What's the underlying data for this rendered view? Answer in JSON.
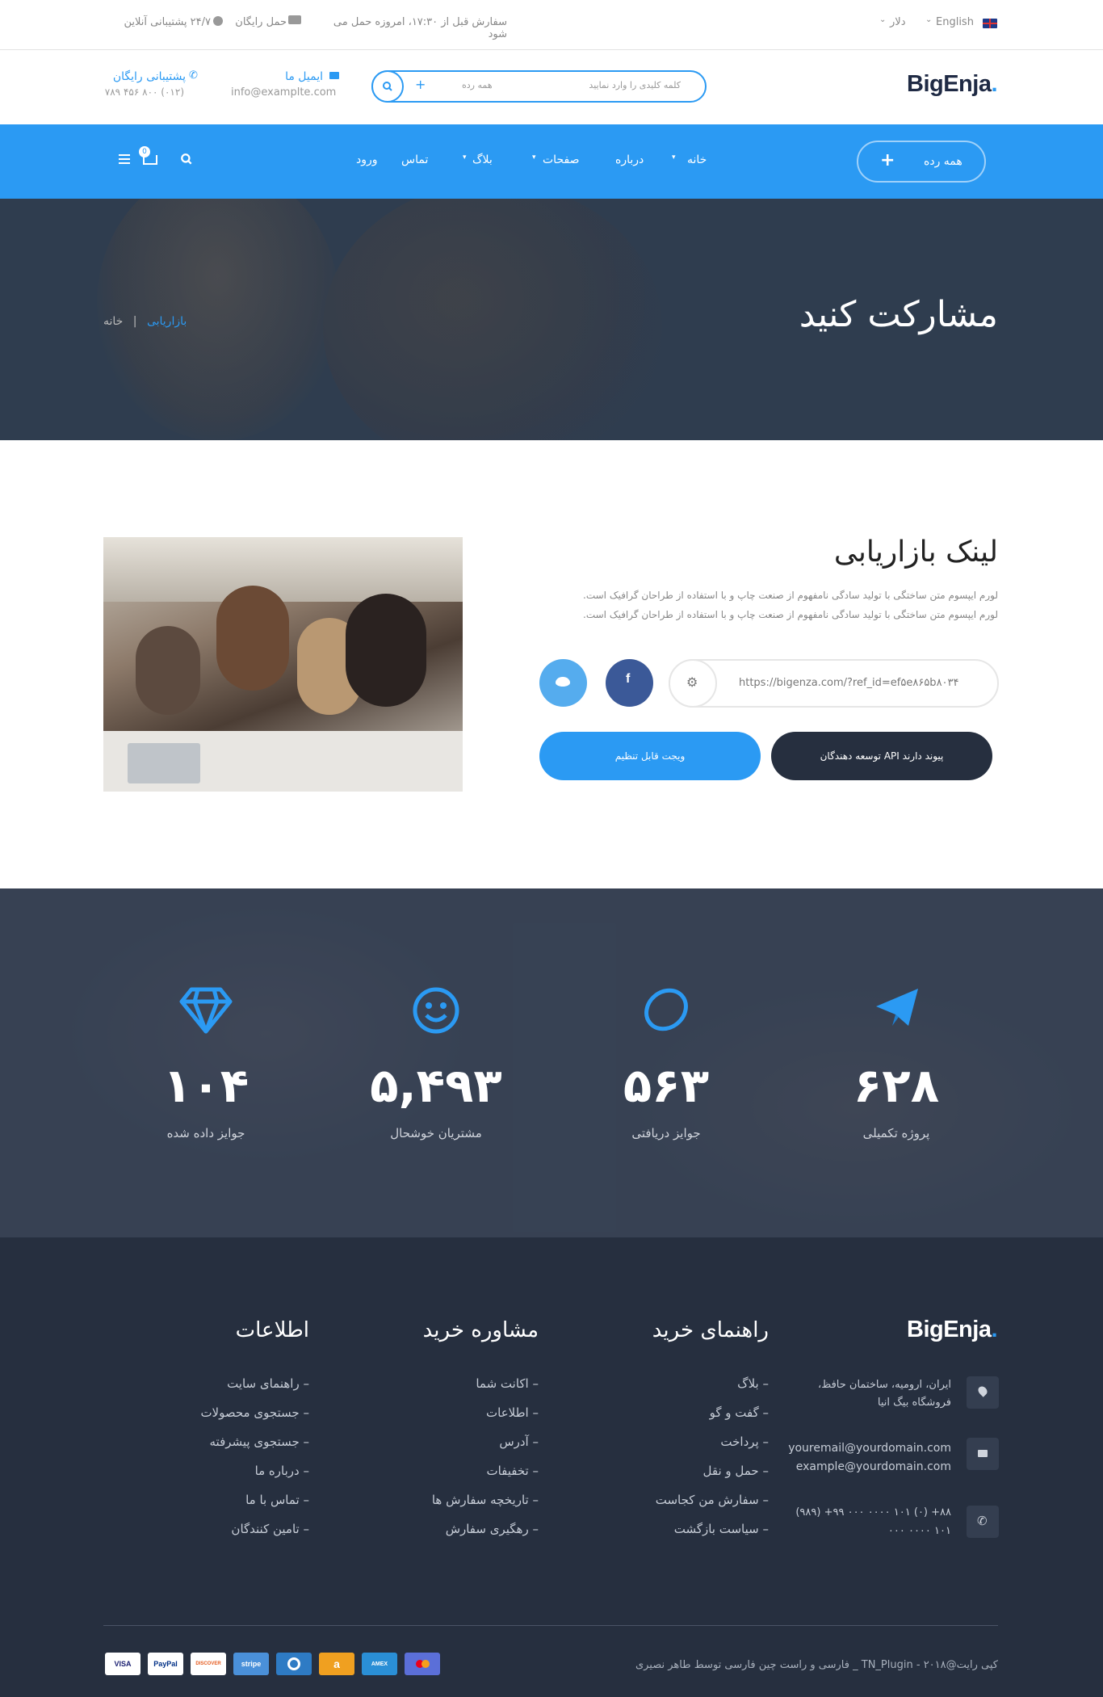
{
  "topbar": {
    "language": "English",
    "currency": "دلار",
    "order_note": "سفارش قبل از ۱۷:۳۰، امروزه حمل می شود",
    "free_shipping": "حمل رایگان",
    "support": "۲۴/۷ پشتیبانی آنلاین"
  },
  "header": {
    "logo": "BigEnja",
    "logo_dot": ".",
    "search_placeholder": "کلمه کلیدی را وارد نمایید",
    "search_category": "همه رده",
    "email_label": "ایمیل ما",
    "email_value": "info@examplte.com",
    "support_label": "پشتیبانی رایگان",
    "support_phone": "(۰۱۲) ۸۰۰ ۴۵۶ ۷۸۹"
  },
  "nav": {
    "category_button": "همه رده",
    "items": [
      "خانه",
      "درباره",
      "صفحات",
      "بلاگ",
      "تماس",
      "ورود"
    ],
    "cart_count": "0"
  },
  "hero": {
    "title": "مشارکت کنید",
    "breadcrumb_home": "خانه",
    "breadcrumb_sep": "|",
    "breadcrumb_current": "بازاریابی"
  },
  "affiliate": {
    "title": "لینک بازاریابی",
    "desc_line1": "لورم ایپسوم متن ساختگی با تولید سادگی نامفهوم از صنعت چاپ و با استفاده از طراحان گرافیک است.",
    "desc_line2": "لورم ایپسوم متن ساختگی با تولید سادگی نامفهوم از صنعت چاپ و با استفاده از طراحان گرافیک است.",
    "link_value": "https://bigenza.com/?ref_id=ef۵e۸۶۵b۸۰۳۴",
    "btn_api": "توسعه دهندگان API پیوند دارند",
    "btn_widget": "ویجت قابل تنظیم"
  },
  "stats": {
    "items": [
      {
        "icon": "paper-plane-icon",
        "value": "۶۲۸",
        "label": "پروژه تکمیلی"
      },
      {
        "icon": "lemon-icon",
        "value": "۵۶۳",
        "label": "جوایز دریافتی"
      },
      {
        "icon": "smile-icon",
        "value": "۵,۴۹۳",
        "label": "مشتریان خوشحال"
      },
      {
        "icon": "diamond-icon",
        "value": "۱۰۴",
        "label": "جوایز داده شده"
      }
    ]
  },
  "footer": {
    "logo": "BigEnja",
    "address": "ایران، ارومیه، ساختمان حافظ، فروشگاه بیگ انیا",
    "email1": "youremail@yourdomain.com",
    "email2": "example@yourdomain.com",
    "phone1": "۸۸+ (۰) ۱۰۱ ۰۰۰۰ ۰۰۰ ۹۹+ (۹۸۹)",
    "phone2": "۱۰۱ ۰۰۰۰ ۰۰۰",
    "col1_title": "راهنمای خرید",
    "col1": [
      "بلاگ",
      "گفت و گو",
      "پرداخت",
      "حمل و نقل",
      "سفارش من کجاست",
      "سیاست بازگشت"
    ],
    "col2_title": "مشاوره خرید",
    "col2": [
      "اکانت شما",
      "اطلاعات",
      "آدرس",
      "تخفیفات",
      "تاریخچه سفارش ها",
      "رهگیری سفارش"
    ],
    "col3_title": "اطلاعات",
    "col3": [
      "راهنمای سایت",
      "جستجوی محصولات",
      "جستجوی پیشرفته",
      "درباره ما",
      "تماس با ما",
      "تامین کنندگان"
    ],
    "copyright": "کپی رایت@۲۰۱۸ - TN_Plugin _ فارسی و راست چین فارسی توسط طاهر نصیری",
    "payments": [
      "VISA",
      "PayPal",
      "DISCOVER",
      "stripe",
      "Diners",
      "a",
      "AMEX",
      "MC"
    ]
  },
  "colors": {
    "accent": "#2b9af3",
    "dark": "#262f3f",
    "hero": "#2f3d4f"
  }
}
